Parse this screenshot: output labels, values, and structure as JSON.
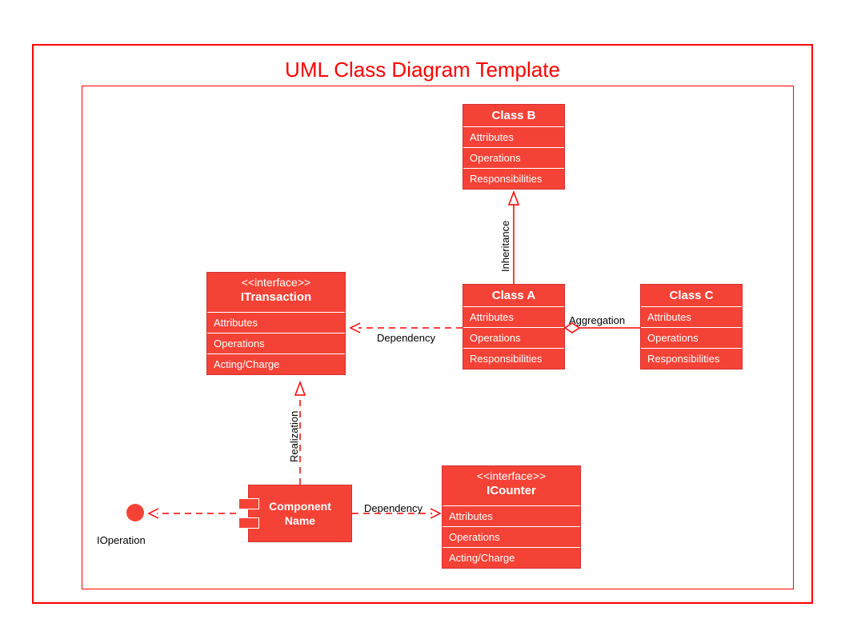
{
  "title": "UML Class Diagram Template",
  "classB": {
    "name": "Class B",
    "r1": "Attributes",
    "r2": "Operations",
    "r3": "Responsibilities"
  },
  "classA": {
    "name": "Class A",
    "r1": "Attributes",
    "r2": "Operations",
    "r3": "Responsibilities"
  },
  "classC": {
    "name": "Class C",
    "r1": "Attributes",
    "r2": "Operations",
    "r3": "Responsibilities"
  },
  "iTransaction": {
    "stereo": "<<interface>>",
    "name": "ITransaction",
    "r1": "Attributes",
    "r2": "Operations",
    "r3": "Acting/Charge"
  },
  "iCounter": {
    "stereo": "<<interface>>",
    "name": "ICounter",
    "r1": "Attributes",
    "r2": "Operations",
    "r3": "Acting/Charge"
  },
  "component": {
    "name": "Component\nName"
  },
  "iOperation": "IOperation",
  "labels": {
    "inheritance": "Inheritance",
    "dependency1": "Dependency",
    "aggregation": "Aggregation",
    "realization": "Realization",
    "dependency2": "Dependency"
  }
}
